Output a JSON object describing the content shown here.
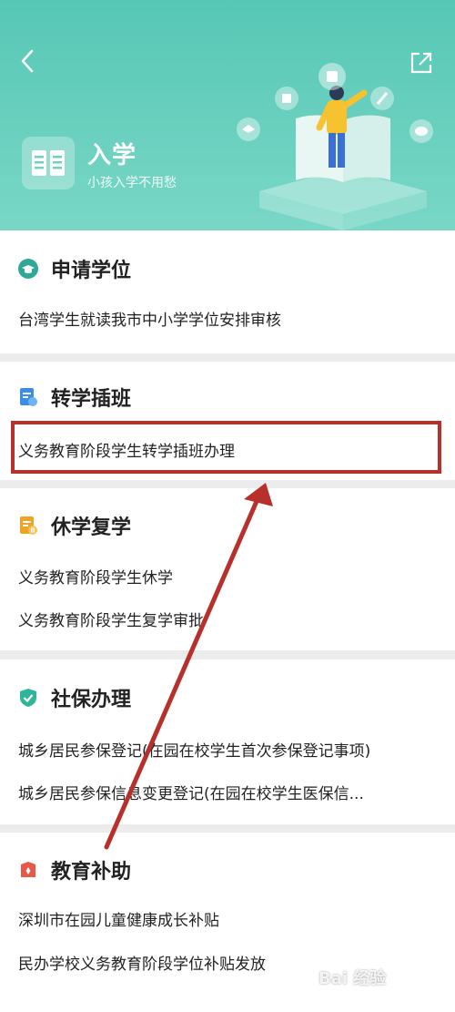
{
  "header": {
    "title": "入学",
    "subtitle": "小孩入学不用愁",
    "colors": {
      "bg_top": "#57c7b5",
      "bg_bottom": "#79d7c6"
    }
  },
  "sections": [
    {
      "title": "申请学位",
      "icon": "graduation-cap-icon",
      "icon_color": "#2fa996",
      "items": [
        "台湾学生就读我市中小学学位安排审核"
      ]
    },
    {
      "title": "转学插班",
      "icon": "document-transfer-icon",
      "icon_color": "#3b8ee8",
      "items": [
        "义务教育阶段学生转学插班办理"
      ]
    },
    {
      "title": "休学复学",
      "icon": "pause-document-icon",
      "icon_color": "#f0a423",
      "items": [
        "义务教育阶段学生休学",
        "义务教育阶段学生复学审批"
      ]
    },
    {
      "title": "社保办理",
      "icon": "shield-check-icon",
      "icon_color": "#2fb59a",
      "items": [
        "城乡居民参保登记(在园在校学生首次参保登记事项)",
        "城乡居民参保信息变更登记(在园在校学生医保信..."
      ]
    },
    {
      "title": "教育补助",
      "icon": "subsidy-badge-icon",
      "icon_color": "#e9574a",
      "items": [
        "深圳市在园儿童健康成长补贴",
        "民办学校义务教育阶段学位补贴发放"
      ]
    }
  ],
  "annotation": {
    "color": "#b8302b"
  },
  "watermark": "Bai 经验"
}
